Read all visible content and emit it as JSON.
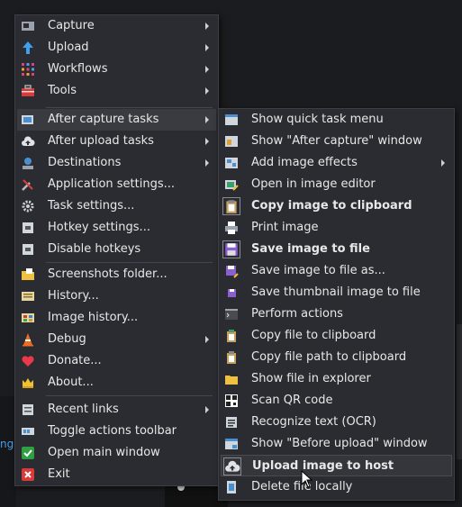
{
  "background": {
    "link_text": "ng"
  },
  "main_menu": {
    "items": [
      {
        "label": "Capture",
        "icon": "capture-icon",
        "submenu": true
      },
      {
        "label": "Upload",
        "icon": "upload-arrow-icon",
        "submenu": true
      },
      {
        "label": "Workflows",
        "icon": "workflows-grid-icon",
        "submenu": true
      },
      {
        "label": "Tools",
        "icon": "toolbox-icon",
        "submenu": true
      },
      {
        "label": "After capture tasks",
        "icon": "after-capture-icon",
        "submenu": true,
        "active": true
      },
      {
        "label": "After upload tasks",
        "icon": "cloud-upload-icon",
        "submenu": true
      },
      {
        "label": "Destinations",
        "icon": "destinations-icon",
        "submenu": true
      },
      {
        "label": "Application settings...",
        "icon": "wrench-screwdriver-icon"
      },
      {
        "label": "Task settings...",
        "icon": "gear-icon"
      },
      {
        "label": "Hotkey settings...",
        "icon": "keyboard-icon"
      },
      {
        "label": "Disable hotkeys",
        "icon": "keyboard-disabled-icon"
      },
      {
        "label": "Screenshots folder...",
        "icon": "folder-icon"
      },
      {
        "label": "History...",
        "icon": "history-icon"
      },
      {
        "label": "Image history...",
        "icon": "image-history-icon"
      },
      {
        "label": "Debug",
        "icon": "traffic-cone-icon",
        "submenu": true
      },
      {
        "label": "Donate...",
        "icon": "heart-icon"
      },
      {
        "label": "About...",
        "icon": "crown-icon"
      },
      {
        "label": "Recent links",
        "icon": "recent-links-icon",
        "submenu": true
      },
      {
        "label": "Toggle actions toolbar",
        "icon": "toolbar-icon"
      },
      {
        "label": "Open main window",
        "icon": "check-icon"
      },
      {
        "label": "Exit",
        "icon": "exit-icon"
      }
    ]
  },
  "sub_menu": {
    "items": [
      {
        "label": "Show quick task menu",
        "icon": "quick-task-menu-icon"
      },
      {
        "label": "Show \"After capture\" window",
        "icon": "window-icon"
      },
      {
        "label": "Add image effects",
        "icon": "image-effects-icon",
        "submenu": true
      },
      {
        "label": "Open in image editor",
        "icon": "image-editor-icon"
      },
      {
        "label": "Copy image to clipboard",
        "icon": "clipboard-icon",
        "checked": true
      },
      {
        "label": "Print image",
        "icon": "printer-icon"
      },
      {
        "label": "Save image to file",
        "icon": "floppy-disk-icon",
        "checked": true
      },
      {
        "label": "Save image to file as...",
        "icon": "floppy-disk-as-icon"
      },
      {
        "label": "Save thumbnail image to file",
        "icon": "floppy-thumbnail-icon"
      },
      {
        "label": "Perform actions",
        "icon": "terminal-icon"
      },
      {
        "label": "Copy file to clipboard",
        "icon": "copy-file-icon"
      },
      {
        "label": "Copy file path to clipboard",
        "icon": "copy-path-icon"
      },
      {
        "label": "Show file in explorer",
        "icon": "explorer-folder-icon"
      },
      {
        "label": "Scan QR code",
        "icon": "qr-code-icon"
      },
      {
        "label": "Recognize text (OCR)",
        "icon": "ocr-text-icon"
      },
      {
        "label": "Show \"Before upload\" window",
        "icon": "before-upload-window-icon"
      },
      {
        "label": "Upload image to host",
        "icon": "cloud-upload-host-icon",
        "checked": true,
        "hover": true
      },
      {
        "label": "Delete file locally",
        "icon": "delete-file-icon"
      }
    ]
  },
  "colors": {
    "menu_bg": "#2b2c31",
    "highlight": "#3a3b41",
    "text": "#e8e8e8"
  }
}
